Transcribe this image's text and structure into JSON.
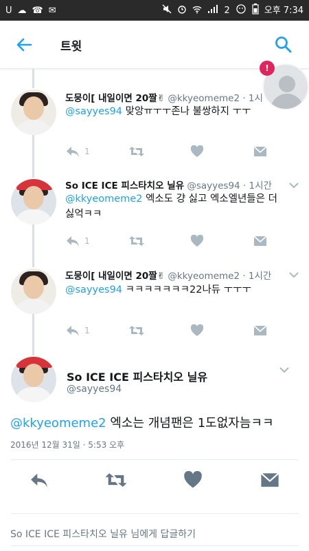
{
  "status_bar": {
    "left_icons": [
      "U",
      "☁",
      "☎",
      "✉"
    ],
    "network": "2",
    "time": "오후 7:34"
  },
  "header": {
    "title": "트윗"
  },
  "notification": {
    "badge": "!"
  },
  "tweets": [
    {
      "name": "도뭉이[ 내일이면 20짤✌",
      "handle": "@kkyeomeme2 · 1시",
      "mention": "@sayyes94",
      "text": " 맞앙ㅠㅜㅜ존나 불쌍하지 ㅜㅜ",
      "reply_count": "1"
    },
    {
      "name": "So ICE ICE 피스타치오 닐유",
      "handle": "@sayyes94 · 1시간",
      "mention": "@kkyeomeme2",
      "text": " 엑소도 걍 싫고 엑소엘년들은 더 싫억ㅋㅋ",
      "reply_count": "1"
    },
    {
      "name": "도뭉이[ 내일이면 20짤✌",
      "handle": "@kkyeomeme2 · 1시간",
      "mention": "@sayyes94",
      "text": " ㅋㅋㅋㅋㅋㅋㅋ22나듀 ㅜㅜㅜ",
      "reply_count": "1"
    }
  ],
  "main_tweet": {
    "name": "So ICE ICE 피스타치오 닐유",
    "handle": "@sayyes94",
    "mention": "@kkyeomeme2",
    "text": " 엑소는 개념팬은 1도없자늠ㅋㅋ",
    "date": "2016년 12월 31일 · 5:53 오후"
  },
  "reply_bar": {
    "prefix": "So ICE ICE",
    "name": " 피스타치오 닐유",
    "suffix": " 님에게 답글하기"
  },
  "colors": {
    "accent": "#1da1f2",
    "icon_gray": "#aab8c2",
    "badge": "#e0245e"
  }
}
